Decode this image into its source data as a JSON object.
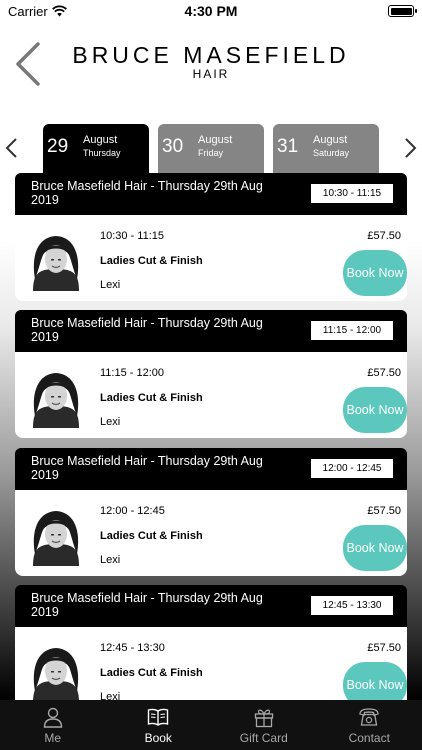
{
  "status": {
    "carrier": "Carrier",
    "time": "4:30 PM"
  },
  "header": {
    "brand_name": "BRUCE MASEFIELD",
    "brand_sub": "HAIR"
  },
  "tabs": [
    {
      "day": "29",
      "month": "August",
      "weekday": "Thursday",
      "active": true
    },
    {
      "day": "30",
      "month": "August",
      "weekday": "Friday",
      "active": false
    },
    {
      "day": "31",
      "month": "August",
      "weekday": "Saturday",
      "active": false
    }
  ],
  "slots": [
    {
      "title": "Bruce Masefield Hair - Thursday 29th Aug 2019",
      "time": "10:30 - 11:15",
      "service": "Ladies Cut & Finish",
      "stylist": "Lexi",
      "price": "£57.50",
      "book_label": "Book Now"
    },
    {
      "title": "Bruce Masefield Hair - Thursday 29th Aug 2019",
      "time": "11:15 - 12:00",
      "service": "Ladies Cut & Finish",
      "stylist": "Lexi",
      "price": "£57.50",
      "book_label": "Book Now"
    },
    {
      "title": "Bruce Masefield Hair - Thursday 29th Aug 2019",
      "time": "12:00 - 12:45",
      "service": "Ladies Cut & Finish",
      "stylist": "Lexi",
      "price": "£57.50",
      "book_label": "Book Now"
    },
    {
      "title": "Bruce Masefield Hair - Thursday 29th Aug 2019",
      "time": "12:45 - 13:30",
      "service": "Ladies Cut & Finish",
      "stylist": "Lexi",
      "price": "£57.50",
      "book_label": "Book Now"
    }
  ],
  "tab_bar": [
    {
      "label": "Me",
      "icon": "person-icon",
      "active": false
    },
    {
      "label": "Book",
      "icon": "book-icon",
      "active": true
    },
    {
      "label": "Gift Card",
      "icon": "gift-icon",
      "active": false
    },
    {
      "label": "Contact",
      "icon": "phone-icon",
      "active": false
    }
  ],
  "colors": {
    "accent": "#5cc8bd",
    "tab_inactive": "#858585",
    "bar": "#111111"
  }
}
